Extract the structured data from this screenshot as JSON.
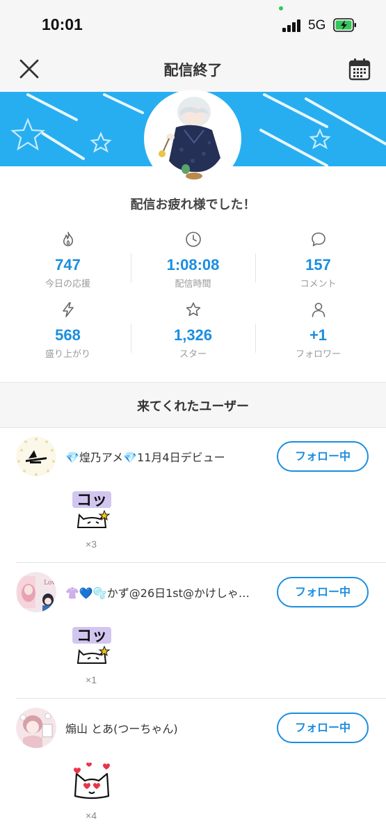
{
  "status_bar": {
    "time": "10:01",
    "network": "5G"
  },
  "nav": {
    "title": "配信終了",
    "close_icon": "close-icon",
    "calendar_icon": "calendar-icon"
  },
  "banner": {
    "color": "#27aef1"
  },
  "summary": {
    "heading": "配信お疲れ様でした！",
    "stats": [
      {
        "icon": "flame-icon",
        "value": "747",
        "label": "今日の応援"
      },
      {
        "icon": "clock-icon",
        "value": "1:08:08",
        "label": "配信時間"
      },
      {
        "icon": "comment-icon",
        "value": "157",
        "label": "コメント"
      },
      {
        "icon": "lightning-icon",
        "value": "568",
        "label": "盛り上がり"
      },
      {
        "icon": "star-icon",
        "value": "1,326",
        "label": "スター"
      },
      {
        "icon": "person-icon",
        "value": "+1",
        "label": "フォロワー"
      }
    ]
  },
  "visitors": {
    "heading": "来てくれたユーザー",
    "users": [
      {
        "name": "💎煌乃アメ💎11月4日デビュー",
        "follow_label": "フォロー中",
        "sticker_text": "コッ",
        "count": "×3"
      },
      {
        "name": "👚💙🫧かず@26日1st@かけしゃ…",
        "follow_label": "フォロー中",
        "sticker_text": "コッ",
        "count": "×1"
      },
      {
        "name": "煽山 とあ(つーちゃん)",
        "follow_label": "フォロー中",
        "sticker_text": "",
        "count": "×4"
      }
    ]
  },
  "colors": {
    "accent": "#1a8ee0",
    "nav_bg": "#f6f6f7"
  }
}
